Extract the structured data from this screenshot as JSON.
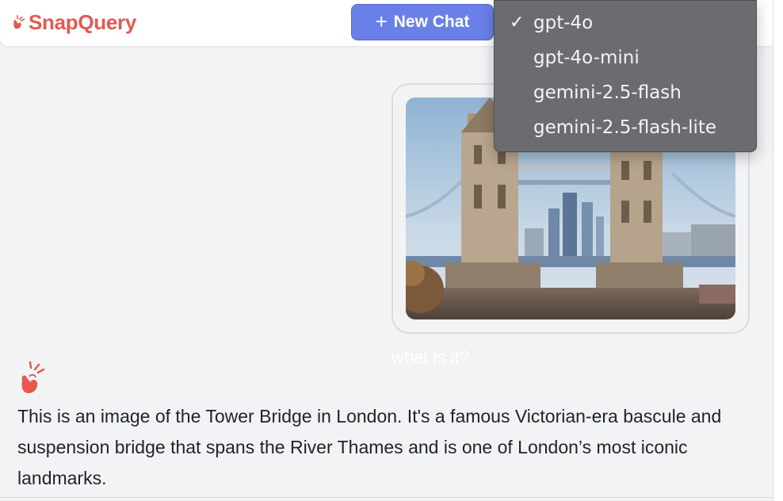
{
  "app": {
    "name": "SnapQuery",
    "brand_color": "#e05a52",
    "accent_color": "#6a80e9"
  },
  "header": {
    "logo_icon": "snap-fingers-icon",
    "new_chat_label": "New Chat",
    "new_chat_icon": "plus-icon"
  },
  "model_dropdown": {
    "selected": "gpt-4o",
    "options": [
      {
        "label": "gpt-4o",
        "selected": true
      },
      {
        "label": "gpt-4o-mini",
        "selected": false
      },
      {
        "label": "gemini-2.5-flash",
        "selected": false
      },
      {
        "label": "gemini-2.5-flash-lite",
        "selected": false
      }
    ],
    "check_icon": "checkmark-icon"
  },
  "conversation": {
    "user_message": {
      "image_subject": "Tower Bridge photo",
      "text": "what is it?"
    },
    "assistant_message": {
      "icon": "snap-fingers-icon",
      "text": "This is an image of the Tower Bridge in London. It's a famous Victorian-era bascule and suspension bridge that spans the River Thames and is one of London’s most iconic landmarks."
    }
  }
}
